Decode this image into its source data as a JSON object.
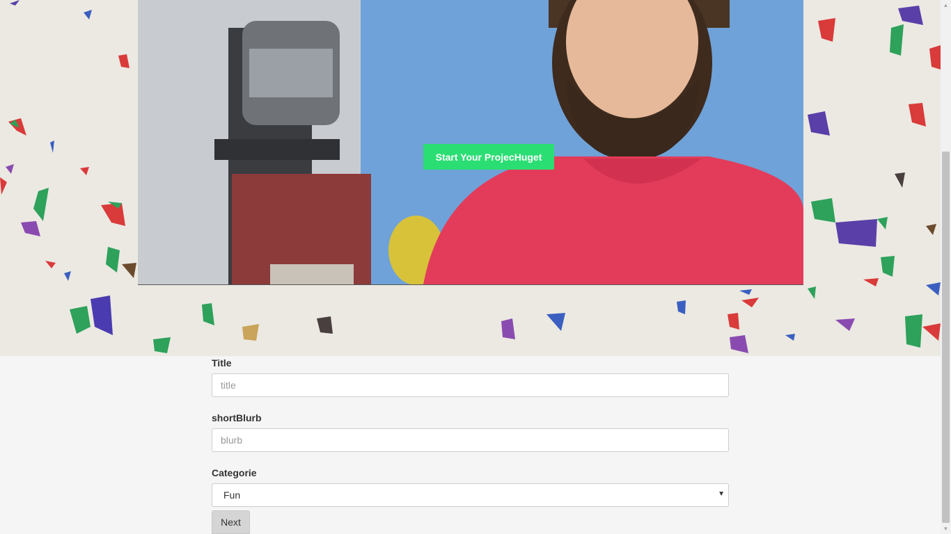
{
  "hero": {
    "cta_label": "Start Your ProjecHuget"
  },
  "form": {
    "title_label": "Title",
    "title_placeholder": "title",
    "blurb_label": "shortBlurb",
    "blurb_placeholder": "blurb",
    "category_label": "Categorie",
    "category_selected": "Fun",
    "next_label": "Next"
  },
  "colors": {
    "cta_green": "#2bde73",
    "page_bg": "#f5f5f5"
  }
}
